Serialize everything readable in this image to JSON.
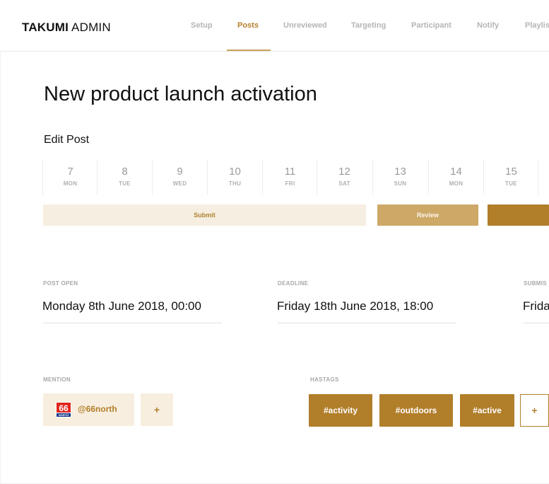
{
  "brand": {
    "bold": "TAKUMI",
    "thin": "ADMIN"
  },
  "nav": {
    "items": [
      {
        "label": "Setup"
      },
      {
        "label": "Posts"
      },
      {
        "label": "Unreviewed"
      },
      {
        "label": "Targeting"
      },
      {
        "label": "Participant"
      },
      {
        "label": "Notify"
      },
      {
        "label": "Playlist"
      }
    ],
    "active": "Posts"
  },
  "page": {
    "title": "New product launch activation",
    "section": "Edit Post"
  },
  "days": [
    {
      "num": "7",
      "dow": "MON"
    },
    {
      "num": "8",
      "dow": "TUE"
    },
    {
      "num": "9",
      "dow": "WED"
    },
    {
      "num": "10",
      "dow": "THU"
    },
    {
      "num": "11",
      "dow": "FRI"
    },
    {
      "num": "12",
      "dow": "SAT"
    },
    {
      "num": "13",
      "dow": "SUN"
    },
    {
      "num": "14",
      "dow": "MON"
    },
    {
      "num": "15",
      "dow": "TUE"
    }
  ],
  "status": {
    "submit": "Submit",
    "review": "Review"
  },
  "fields": {
    "post_open": {
      "label": "POST OPEN",
      "value": "Monday 8th June 2018, 00:00"
    },
    "deadline": {
      "label": "DEADLINE",
      "value": "Friday 18th June 2018, 18:00"
    },
    "submission": {
      "label": "SUBMIS",
      "value": "Frida"
    }
  },
  "mention": {
    "label": "MENTION",
    "handle": "@66north",
    "logo_text": "66",
    "logo_subtext": "NORTH",
    "add": "+"
  },
  "hashtags": {
    "label": "HASTAGS",
    "items": [
      "#activity",
      "#outdoors",
      "#active"
    ],
    "add": "+"
  },
  "colors": {
    "accent": "#b17e2a",
    "accent_light": "#f6eee0",
    "accent_mid": "#cda867"
  }
}
